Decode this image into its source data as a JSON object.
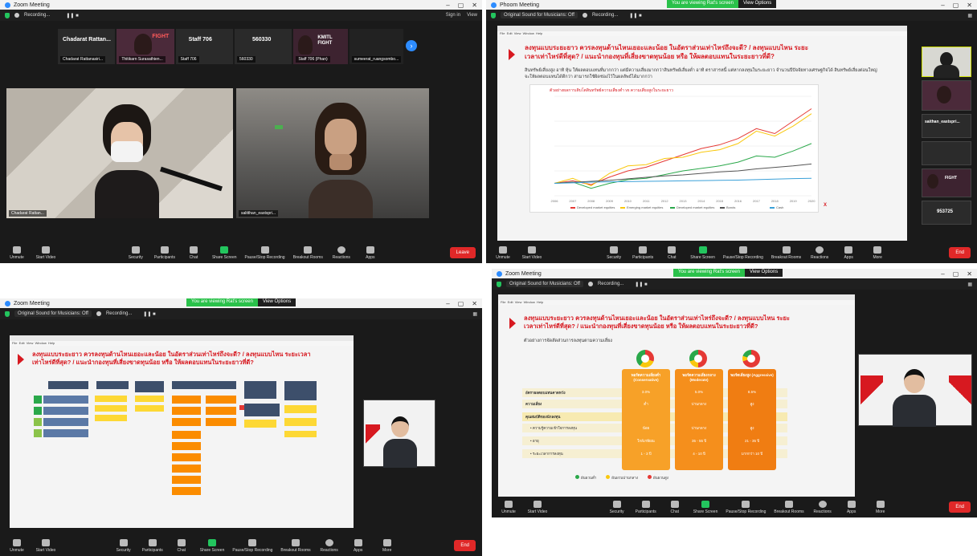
{
  "panels": {
    "p1": {
      "window_title": "Zoom Meeting",
      "meeting_name": "",
      "recording_label": "Recording...",
      "topbar_right": [
        "Sign in",
        "View"
      ],
      "strip": [
        {
          "caption": "Chadarat Rattan...",
          "sub": "Chadarat Rattanasiri..."
        },
        {
          "caption": "",
          "sub": "Thitikarn Surasathien..."
        },
        {
          "caption": "Staff 706",
          "sub": "Staff 706"
        },
        {
          "caption": "560330",
          "sub": "560330"
        },
        {
          "caption": "",
          "sub": "Staff 706 (Phan)"
        },
        {
          "caption": "",
          "sub": "sumeerat_ruangsombo..."
        }
      ],
      "tile_names": [
        "Chadarat Rattan...",
        "salitthan_eastspri..."
      ]
    },
    "p2": {
      "window_title": "Phoom Meeting",
      "share_banner": "You are viewing Rat's screen",
      "view_options": "View Options",
      "meeting_name": "Original Sound for Musicians: Off",
      "recording_label": "Recording...",
      "slide_title": "ลงทุนแบบระยะยาว ควรลงทุนด้านไหนเยอะและน้อย ในอัตราส่วนเท่าไหร่ถึงจะดี? / ลงทุนแบบไหน ระยะเวลาเท่าไหร่ดีที่สุด? / แนะนำกองทุนที่เสี่ยงขาดทุนน้อย หรือ ให้ผลตอบแทนในระยะยาวที่ดี?",
      "slide_text": "สินทรัพย์เสี่ยงสูง อาทิ หุ้น ให้ผลตอบแทนที่มากกว่า แต่มีความเสี่ยงมากกว่าสินทรัพย์เสี่ยงต่ำ อาทิ ตราสารหนี้ แต่หากลงทุนในระยะยาว จำนวนปีปัจจัยทางเศรษฐกิจได้ สินทรัพย์เสี่ยงต่อนใหญ่จะให้ผลตอบแทนได้ดีกว่า สามารถใช้ผิดช่องไว้ในผลลัพธ์ได้มากกว่า",
      "chart_caption": "ตัวอย่างผลการเติบโตสินทรัพย์ความเสี่ยงต่ำ vs ความเสี่ยงสูงในระยะยาว",
      "side_labels": [
        "saithan_eastspri...",
        "953725"
      ],
      "end_label": "End"
    },
    "p3": {
      "window_title": "Zoom Meeting",
      "share_banner": "You are viewing Rat's screen",
      "view_options": "View Options",
      "meeting_name": "Original Sound for Musicians: Off",
      "recording_label": "Recording...",
      "slide_title": "ลงทุนแบบระยะยาว ควรลงทุนด้านไหนเยอะและน้อย ในอัตราส่วนเท่าไหร่ถึงจะดี? / ลงทุนแบบไหน ระยะเวลาเท่าไหร่ดีที่สุด? / แนะนำกองทุนที่เสี่ยงขาดทุนน้อย หรือ ให้ผลตอบแทนในระยะยาวที่ดี?",
      "end_label": "End"
    },
    "p4": {
      "window_title": "Zoom Meeting",
      "share_banner": "You are viewing Rat's screen",
      "view_options": "View Options",
      "meeting_name": "Original Sound for Musicians: Off",
      "recording_label": "Recording...",
      "slide_title": "ลงทุนแบบระยะยาว ควรลงทุนด้านไหนเยอะและน้อย ในอัตราส่วนเท่าไหร่ถึงจะดี? / ลงทุนแบบไหน ระยะเวลาเท่าไหร่ดีที่สุด? / แนะนำกองทุนที่เสี่ยงขาดทุนน้อย หรือ ให้ผลตอบแทนในระยะยาวที่ดี?",
      "slide_sub": "ตัวอย่างการจัดสัดส่วนการลงทุนตามความเสี่ยง",
      "portfolio_headers": [
        "พอร์ตความเสี่ยงต่ำ (Conservative)",
        "พอร์ตความเสี่ยงกลาง (Moderate)",
        "พอร์ตเสี่ยงสูง (Aggressive)"
      ],
      "row_labels": [
        "อัตราผลตอบแทนคาดหวัง",
        "ความเสี่ยง",
        "คุณสมบัติของนักลงทุน",
        "ความรู้ความเข้าใจการลงทุน",
        "อายุ",
        "ระยะเวลาการลงทุน"
      ],
      "cells": [
        [
          "3.0%",
          "5.0%",
          "8.5%"
        ],
        [
          "ต่ำ",
          "ปานกลาง",
          "สูง"
        ],
        [
          "",
          "",
          ""
        ],
        [
          "น้อย",
          "ปานกลาง",
          "สูง"
        ],
        [
          "ใกล้เกษียณ",
          "35 - 55 ปี",
          "21 - 35 ปี"
        ],
        [
          "1 - 3 ปี",
          "4 - 10 ปี",
          "มากกว่า 10 ปี"
        ]
      ],
      "legend": [
        "ผันผวนต่ำ",
        "ผันผวนปานกลาง",
        "ผันผวนสูง"
      ],
      "end_label": "End"
    }
  },
  "toolbar": {
    "items": [
      "Unmute",
      "Start Video",
      "Security",
      "Participants",
      "Chat",
      "Share Screen",
      "Pause/Stop Recording",
      "Breakout Rooms",
      "Reactions",
      "Apps",
      "More"
    ],
    "participants_count": "106",
    "leave_label": "Leave",
    "end_label": "End"
  },
  "chart_data": {
    "type": "line",
    "title": "ตัวอย่างผลการเติบโตสินทรัพย์ความเสี่ยงต่ำ vs ความเสี่ยงสูงในระยะยาว",
    "x": [
      2006,
      2007,
      2008,
      2009,
      2010,
      2011,
      2012,
      2013,
      2014,
      2015,
      2016,
      2017,
      2018,
      2019,
      2020
    ],
    "ylim": [
      50,
      450
    ],
    "series": [
      {
        "name": "Developed market equities",
        "color": "#e53935",
        "values": [
          100,
          110,
          95,
          125,
          150,
          165,
          190,
          215,
          240,
          255,
          280,
          320,
          300,
          350,
          400
        ]
      },
      {
        "name": "Emerging market equities",
        "color": "#f9c80e",
        "values": [
          100,
          120,
          90,
          140,
          170,
          175,
          200,
          205,
          225,
          235,
          260,
          310,
          290,
          330,
          380
        ]
      },
      {
        "name": "Developed market equities",
        "color": "#2aa84a",
        "values": [
          100,
          105,
          80,
          100,
          115,
          120,
          135,
          150,
          160,
          170,
          185,
          210,
          205,
          230,
          260
        ]
      },
      {
        "name": "Bonds",
        "color": "#555555",
        "values": [
          100,
          104,
          108,
          112,
          118,
          124,
          130,
          134,
          140,
          146,
          150,
          158,
          164,
          170,
          178
        ]
      },
      {
        "name": "Cash",
        "color": "#3aa0d8",
        "values": [
          100,
          102,
          105,
          106,
          107,
          108,
          109,
          110,
          111,
          112,
          113,
          115,
          117,
          119,
          120
        ]
      }
    ]
  }
}
